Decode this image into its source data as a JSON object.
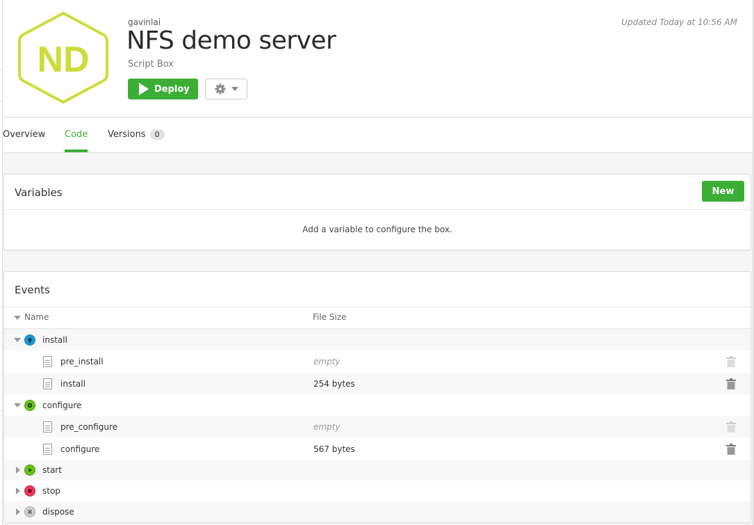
{
  "header": {
    "logo_initials": "ND",
    "owner": "gavinlai",
    "title": "NFS demo server",
    "subtitle": "Script Box",
    "deploy_label": "Deploy",
    "updated": "Updated Today at 10:56 AM",
    "brand_color": "#cddc39",
    "accent_color": "#3cae35"
  },
  "tabs": [
    {
      "label": "Overview",
      "active": false
    },
    {
      "label": "Code",
      "active": true
    },
    {
      "label": "Versions",
      "badge": "0",
      "active": false
    }
  ],
  "variables": {
    "title": "Variables",
    "new_label": "New",
    "empty_message": "Add a variable to configure the box."
  },
  "events": {
    "title": "Events",
    "columns": {
      "name": "Name",
      "size": "File Size"
    },
    "groups": [
      {
        "name": "install",
        "icon": "arrow-up-icon",
        "expanded": true,
        "files": [
          {
            "name": "pre_install",
            "size": "empty",
            "is_empty": true
          },
          {
            "name": "install",
            "size": "254 bytes",
            "is_empty": false
          }
        ]
      },
      {
        "name": "configure",
        "icon": "gear-icon",
        "expanded": true,
        "files": [
          {
            "name": "pre_configure",
            "size": "empty",
            "is_empty": true
          },
          {
            "name": "configure",
            "size": "567 bytes",
            "is_empty": false
          }
        ]
      },
      {
        "name": "start",
        "icon": "play-icon",
        "expanded": false,
        "files": []
      },
      {
        "name": "stop",
        "icon": "stop-icon",
        "expanded": false,
        "files": []
      },
      {
        "name": "dispose",
        "icon": "x-icon",
        "expanded": false,
        "files": []
      }
    ]
  }
}
